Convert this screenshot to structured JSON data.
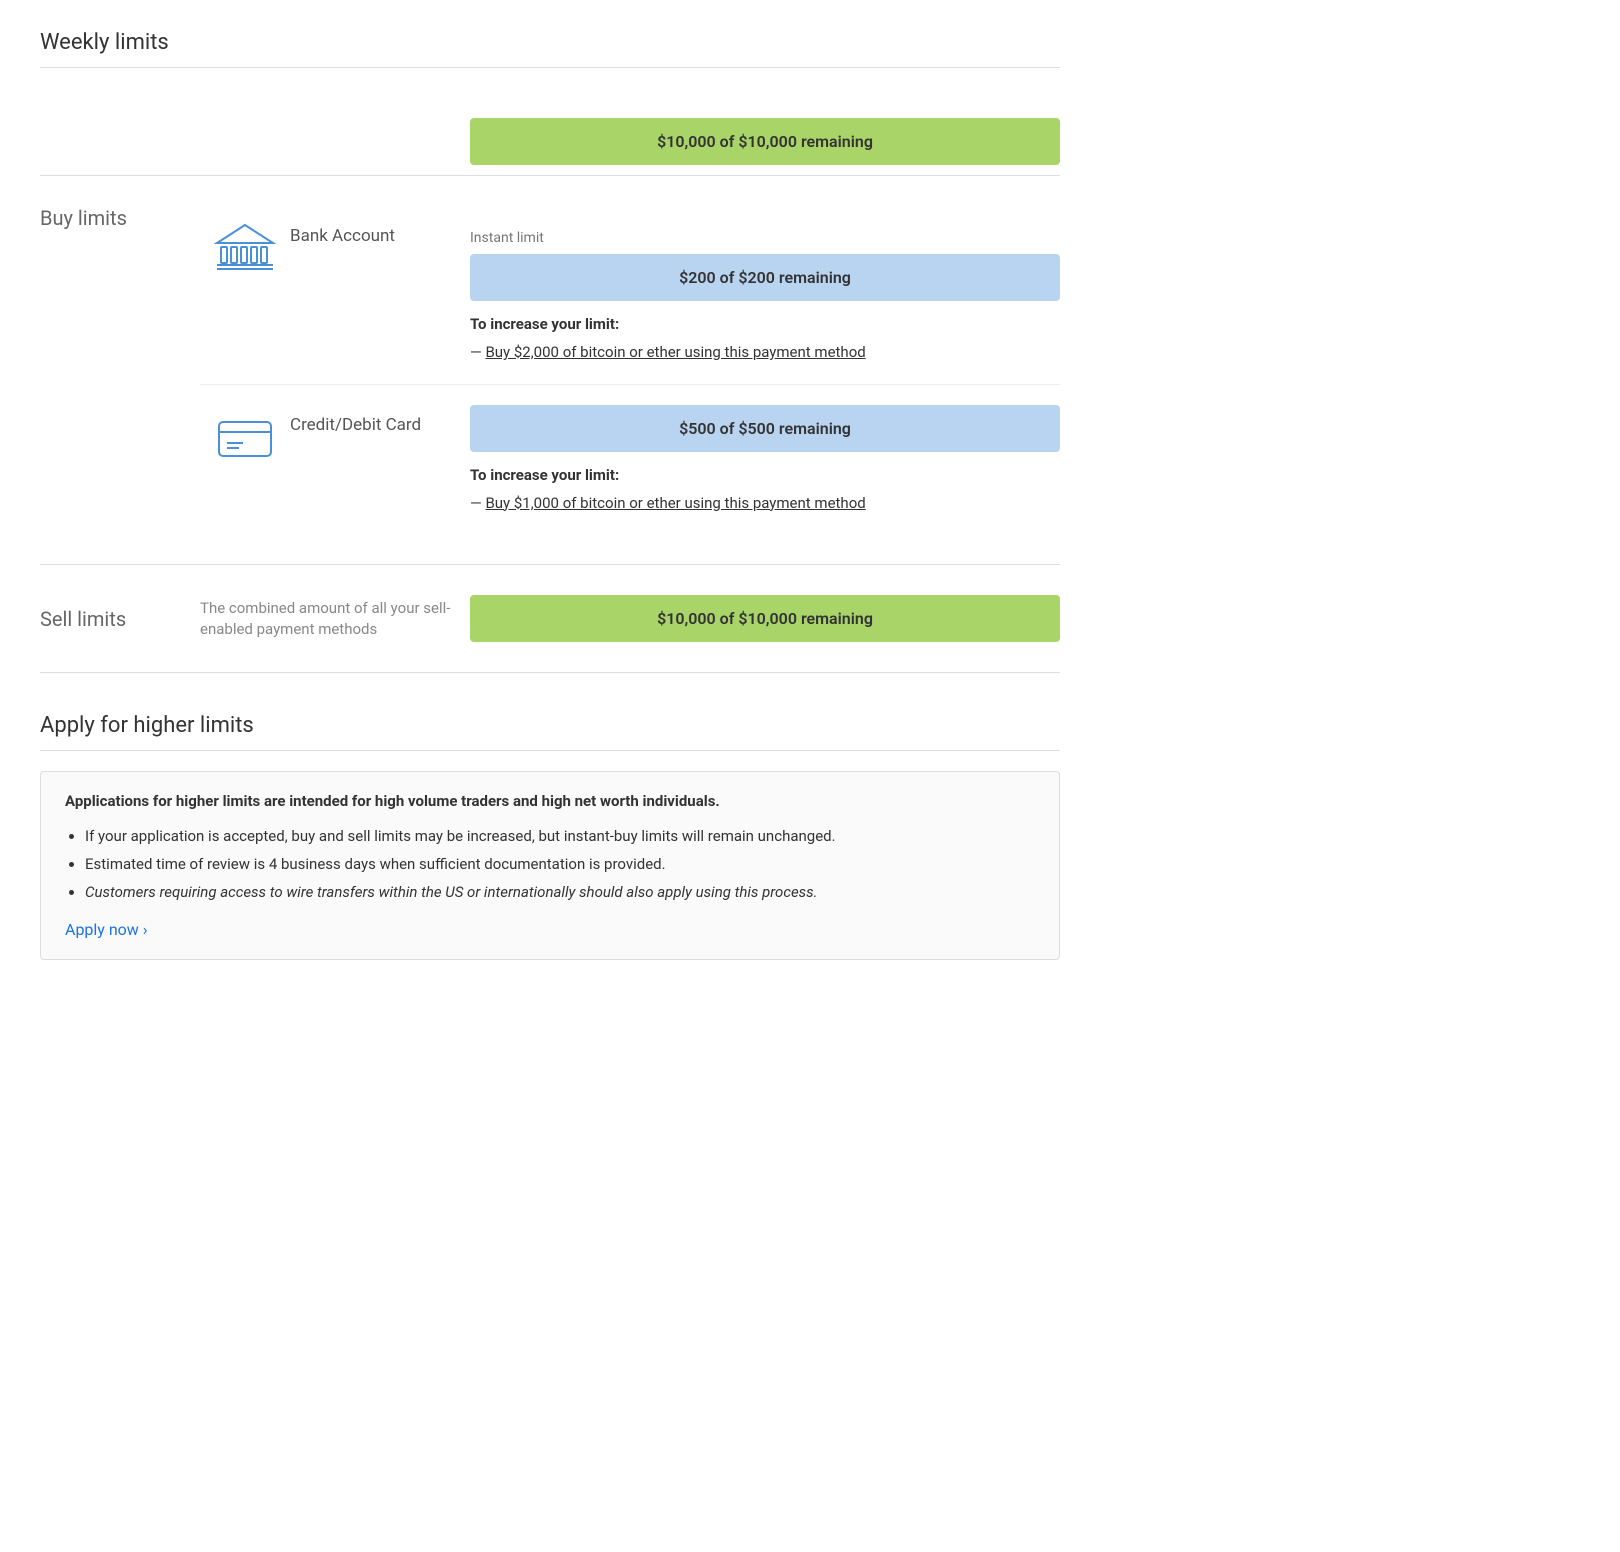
{
  "page": {
    "weekly_limits_title": "Weekly limits",
    "weekly_bar_text": "$10,000 of $10,000 remaining",
    "buy_limits_label": "Buy limits",
    "bank_account": {
      "name": "Bank Account",
      "instant_limit_label": "Instant limit",
      "instant_bar_text": "$200 of $200 remaining",
      "increase_title": "To increase your limit:",
      "increase_link_text": "Buy $2,000 of bitcoin or ether using this payment method",
      "increase_prefix": "— "
    },
    "credit_card": {
      "name": "Credit/Debit Card",
      "bar_text": "$500 of $500 remaining",
      "increase_title": "To increase your limit:",
      "increase_link_text": "Buy $1,000 of bitcoin or ether using this payment method",
      "increase_prefix": "— "
    },
    "sell_limits_label": "Sell limits",
    "sell_description": "The combined amount of all your sell-enabled payment methods",
    "sell_bar_text": "$10,000 of $10,000 remaining",
    "apply_section_title": "Apply for higher limits",
    "info_box": {
      "title": "Applications for higher limits are intended for high volume traders and high net worth individuals.",
      "bullets": [
        "If your application is accepted, buy and sell limits may be increased, but instant-buy limits will remain unchanged.",
        "Estimated time of review is 4 business days when sufficient documentation is provided.",
        "Customers requiring access to wire transfers within the US or internationally should also apply using this process."
      ]
    },
    "apply_now_label": "Apply now ›"
  }
}
